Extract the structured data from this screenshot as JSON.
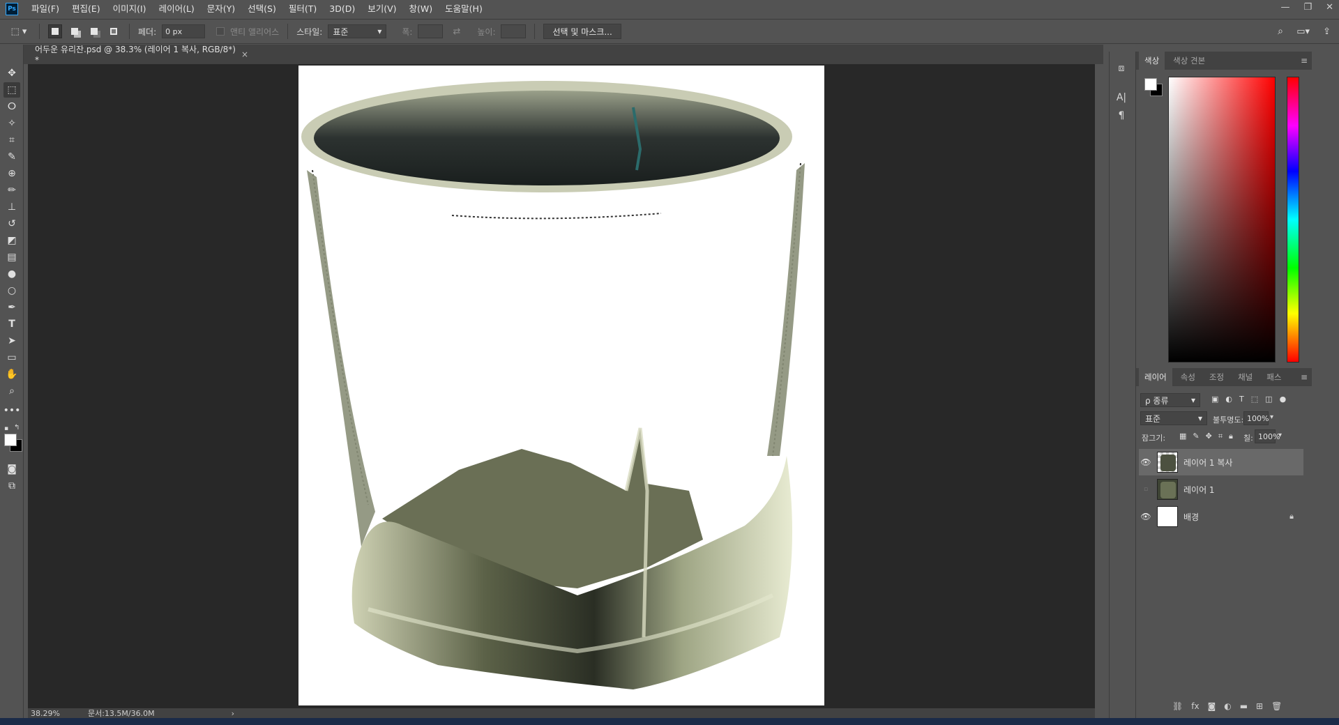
{
  "app": {
    "logo": "Ps",
    "menu": [
      "파일(F)",
      "편집(E)",
      "이미지(I)",
      "레이어(L)",
      "문자(Y)",
      "선택(S)",
      "필터(T)",
      "3D(D)",
      "보기(V)",
      "창(W)",
      "도움말(H)"
    ],
    "window_controls": [
      "minimize-icon",
      "restore-icon",
      "close-icon"
    ]
  },
  "options": {
    "feather_label": "페더:",
    "feather_value": "0 px",
    "antialias_label": "앤티 앨리어스",
    "style_label": "스타일:",
    "style_value": "표준",
    "width_label": "폭:",
    "height_label": "높이:",
    "select_mask_button": "선택 및 마스크..."
  },
  "document": {
    "tab_title": "어두운 유리잔.psd @ 38.3% (레이어 1 복사, RGB/8*) *",
    "close": "×"
  },
  "status": {
    "zoom": "38.29%",
    "doc_size": "문서:13.5M/36.0M",
    "arrow": "›"
  },
  "color_panel": {
    "tabs": [
      "색상",
      "색상 견본"
    ],
    "foreground": "#ffffff",
    "background": "#000000",
    "hue": "#ff0000"
  },
  "layers_panel": {
    "tabs": [
      "레이어",
      "속성",
      "조정",
      "채널",
      "패스"
    ],
    "filter_label": "ρ 종류",
    "blend_mode": "표준",
    "opacity_label": "불투명도:",
    "opacity_value": "100%",
    "lock_label": "잠그기:",
    "fill_label": "칠:",
    "fill_value": "100%",
    "layers": [
      {
        "name": "레이어 1 복사",
        "visible": true,
        "selected": true,
        "locked": false
      },
      {
        "name": "레이어 1",
        "visible": false,
        "selected": false,
        "locked": false
      },
      {
        "name": "배경",
        "visible": true,
        "selected": false,
        "locked": true
      }
    ],
    "bottom_icons": [
      "link-icon",
      "fx-icon",
      "mask-icon",
      "adjustment-icon",
      "folder-icon",
      "new-layer-icon",
      "trash-icon"
    ]
  }
}
